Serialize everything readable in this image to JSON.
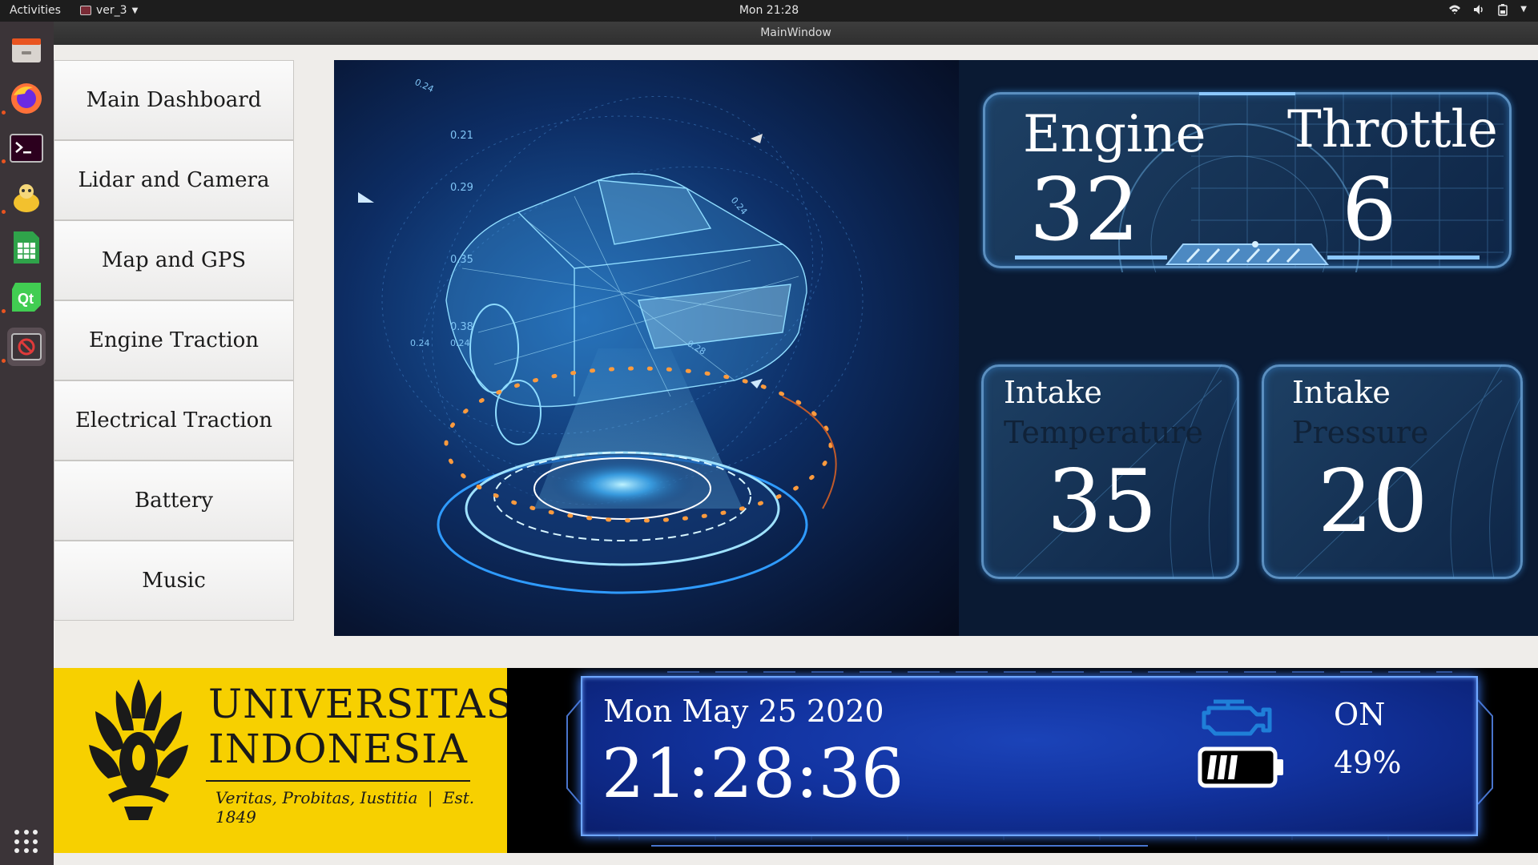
{
  "topbar": {
    "activities": "Activities",
    "app_name": "ver_3",
    "clock": "Mon 21:28",
    "tray_icons": [
      "wifi-icon",
      "volume-icon",
      "battery-icon",
      "chevron-down-icon"
    ]
  },
  "dock": {
    "items": [
      "files-icon",
      "firefox-icon",
      "terminal-icon",
      "python-icon",
      "spreadsheet-icon",
      "qt-creator-icon",
      "running-app-icon"
    ],
    "show_apps_icon": "app-grid-icon"
  },
  "window": {
    "title": "MainWindow"
  },
  "nav": {
    "items": [
      {
        "label": "Main Dashboard"
      },
      {
        "label": "Lidar and Camera"
      },
      {
        "label": "Map and GPS"
      },
      {
        "label": "Engine Traction"
      },
      {
        "label": "Electrical Traction"
      },
      {
        "label": "Battery"
      },
      {
        "label": "Music"
      }
    ]
  },
  "holo": {
    "labels": [
      "0.21",
      "0.29",
      "0.35",
      "0.38",
      "0.24",
      "0.24",
      "0.24",
      "0.24",
      "0.28"
    ]
  },
  "gauges": {
    "engine": {
      "label": "Engine",
      "value": "32"
    },
    "throttle": {
      "label": "Throttle",
      "value": "6"
    },
    "intake_temp": {
      "label_line1": "Intake",
      "label_line2": "Temperature",
      "value": "35"
    },
    "intake_pressure": {
      "label_line1": "Intake",
      "label_line2": "Pressure",
      "value": "20"
    }
  },
  "logo": {
    "line1": "UNIVERSITAS",
    "line2": "INDONESIA",
    "motto": "Veritas, Probitas, Iustitia",
    "established": "Est. 1849",
    "colors": {
      "background": "#f7d000",
      "ink": "#1a1a1a"
    }
  },
  "status": {
    "date": "Mon May 25 2020",
    "time": "21:28:36",
    "engine_state": "ON",
    "battery_level": "49%",
    "engine_icon": "engine-icon",
    "battery_icon": "battery-icon",
    "battery_fill_fraction": 0.49
  }
}
